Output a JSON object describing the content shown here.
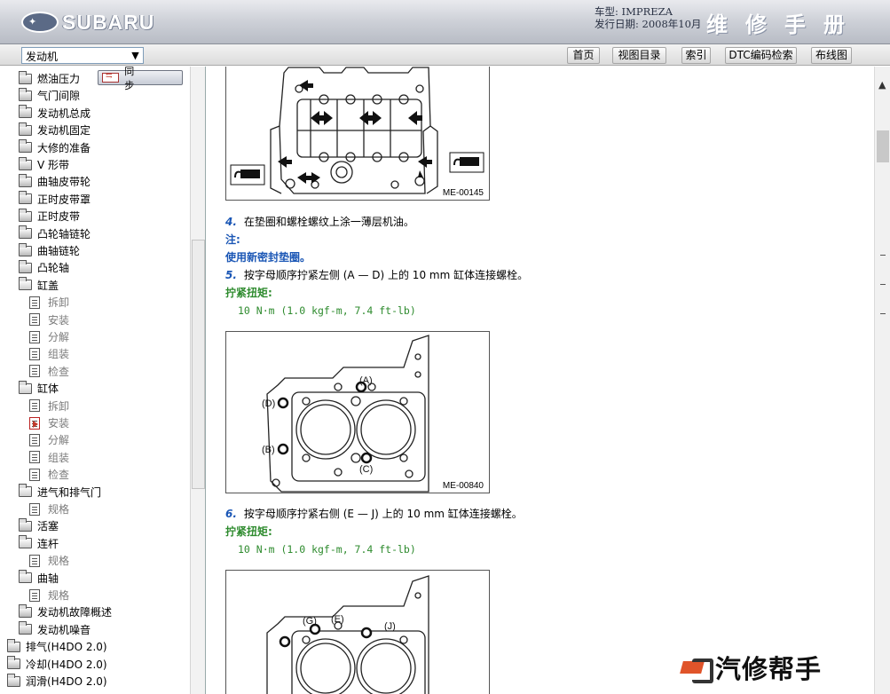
{
  "header": {
    "brand": "SUBARU",
    "model_line": "车型: IMPREZA",
    "date_line": "发行日期: 2008年10月",
    "manual_title": "维修手册"
  },
  "toolbar": {
    "section_select": "发动机",
    "buttons": [
      "首页",
      "视图目录",
      "索引",
      "DTC编码检索",
      "布线图"
    ]
  },
  "sidebar": {
    "sync_label": "同 步",
    "items": [
      {
        "label": "燃油压力",
        "type": "folder"
      },
      {
        "label": "气门间隙",
        "type": "folder"
      },
      {
        "label": "发动机总成",
        "type": "folder"
      },
      {
        "label": "发动机固定",
        "type": "folder"
      },
      {
        "label": "大修的准备",
        "type": "folder"
      },
      {
        "label": "V 形带",
        "type": "folder"
      },
      {
        "label": "曲轴皮带轮",
        "type": "folder"
      },
      {
        "label": "正时皮带罩",
        "type": "folder"
      },
      {
        "label": "正时皮带",
        "type": "folder"
      },
      {
        "label": "凸轮轴链轮",
        "type": "folder"
      },
      {
        "label": "曲轴链轮",
        "type": "folder"
      },
      {
        "label": "凸轮轴",
        "type": "folder"
      },
      {
        "label": "缸盖",
        "type": "folder-open"
      },
      {
        "label": "拆卸",
        "type": "doc"
      },
      {
        "label": "安装",
        "type": "doc"
      },
      {
        "label": "分解",
        "type": "doc"
      },
      {
        "label": "组装",
        "type": "doc"
      },
      {
        "label": "检查",
        "type": "doc"
      },
      {
        "label": "缸体",
        "type": "folder-open"
      },
      {
        "label": "拆卸",
        "type": "doc"
      },
      {
        "label": "安装",
        "type": "doc-active"
      },
      {
        "label": "分解",
        "type": "doc"
      },
      {
        "label": "组装",
        "type": "doc"
      },
      {
        "label": "检查",
        "type": "doc"
      },
      {
        "label": "进气和排气门",
        "type": "folder-open"
      },
      {
        "label": "规格",
        "type": "doc"
      },
      {
        "label": "活塞",
        "type": "folder"
      },
      {
        "label": "连杆",
        "type": "folder-open"
      },
      {
        "label": "规格",
        "type": "doc"
      },
      {
        "label": "曲轴",
        "type": "folder-open"
      },
      {
        "label": "规格",
        "type": "doc"
      },
      {
        "label": "发动机故障概述",
        "type": "folder"
      },
      {
        "label": "发动机噪音",
        "type": "folder"
      },
      {
        "label": "排气(H4DO 2.0)",
        "type": "folder-top"
      },
      {
        "label": "冷却(H4DO 2.0)",
        "type": "folder-top"
      },
      {
        "label": "润滑(H4DO 2.0)",
        "type": "folder-top"
      }
    ]
  },
  "content": {
    "figure1_label": "ME-00145",
    "step4_num": "4.",
    "step4_text": "在垫圈和螺栓螺纹上涂一薄层机油。",
    "note_title": "注:",
    "note_text": "使用新密封垫圈。",
    "step5_num": "5.",
    "step5_text": "按字母顺序拧紧左侧 (A — D) 上的 10 mm 缸体连接螺栓。",
    "torque_title_1": "拧紧扭矩:",
    "torque_value_1": "10 N·m (1.0 kgf-m, 7.4 ft-lb)",
    "figure2_label": "ME-00840",
    "figure2_callouts": [
      "(A)",
      "(B)",
      "(C)",
      "(D)"
    ],
    "step6_num": "6.",
    "step6_text": "按字母顺序拧紧右侧 (E — J) 上的 10 mm 缸体连接螺栓。",
    "torque_title_2": "拧紧扭矩:",
    "torque_value_2": "10 N·m (1.0 kgf-m, 7.4 ft-lb)",
    "figure3_callouts": [
      "(E)",
      "(G)",
      "(J)"
    ]
  },
  "watermark": "汽修帮手"
}
